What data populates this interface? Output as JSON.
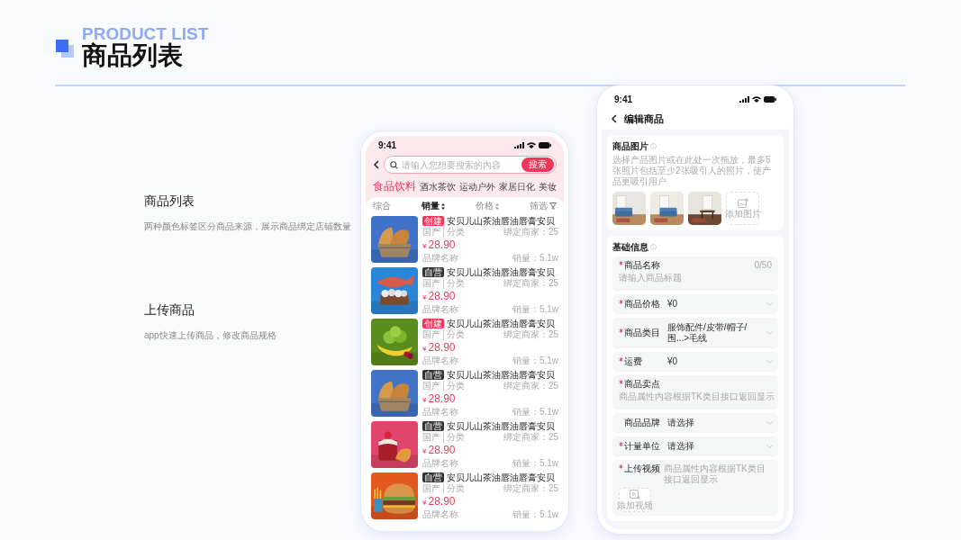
{
  "header": {
    "subtitle": "PRODUCT LIST",
    "title": "商品列表"
  },
  "features": [
    {
      "title": "商品列表",
      "description": "两种颜色标签区分商品来源，展示商品绑定店铺数量"
    },
    {
      "title": "上传商品",
      "description": "app快速上传商品，修改商品规格"
    }
  ],
  "list_screen": {
    "status_time": "9:41",
    "search": {
      "placeholder": "请输入您想要搜索的内容",
      "button": "搜索"
    },
    "tabs": [
      {
        "label": "食品饮料",
        "selected": true
      },
      {
        "label": "酒水茶饮",
        "selected": false
      },
      {
        "label": "运动户外",
        "selected": false
      },
      {
        "label": "家居日化",
        "selected": false
      },
      {
        "label": "美妆",
        "selected": false
      }
    ],
    "sort_options": [
      {
        "label": "综合",
        "kind": "plain",
        "selected": false
      },
      {
        "label": "销量",
        "kind": "sort",
        "selected": true
      },
      {
        "label": "价格",
        "kind": "sort",
        "selected": false
      },
      {
        "label": "筛选",
        "kind": "filter",
        "selected": false
      }
    ],
    "products": [
      {
        "tag": "创建",
        "color": "#f0375a",
        "title": "安贝儿山茶油唇油唇膏安贝",
        "origin": "国产",
        "category": "分类",
        "merchants": "绑定商家：25",
        "currency": "¥",
        "price": "28.90",
        "brand": "品牌名称",
        "sales": "销量：5.1w"
      },
      {
        "tag": "自营",
        "color": "#333333",
        "title": "安贝儿山茶油唇油唇膏安贝",
        "origin": "国产",
        "category": "分类",
        "merchants": "绑定商家：25",
        "currency": "¥",
        "price": "28.90",
        "brand": "品牌名称",
        "sales": "销量：5.1w"
      },
      {
        "tag": "创建",
        "color": "#f0375a",
        "title": "安贝儿山茶油唇油唇膏安贝",
        "origin": "国产",
        "category": "分类",
        "merchants": "绑定商家：25",
        "currency": "¥",
        "price": "28.90",
        "brand": "品牌名称",
        "sales": "销量：5.1w"
      },
      {
        "tag": "自营",
        "color": "#333333",
        "title": "安贝儿山茶油唇油唇膏安贝",
        "origin": "国产",
        "category": "分类",
        "merchants": "绑定商家：25",
        "currency": "¥",
        "price": "28.90",
        "brand": "品牌名称",
        "sales": "销量：5.1w"
      },
      {
        "tag": "自营",
        "color": "#333333",
        "title": "安贝儿山茶油唇油唇膏安贝",
        "origin": "国产",
        "category": "分类",
        "merchants": "绑定商家：25",
        "currency": "¥",
        "price": "28.90",
        "brand": "品牌名称",
        "sales": "销量：5.1w"
      },
      {
        "tag": "自营",
        "color": "#333333",
        "title": "安贝儿山茶油唇油唇膏安贝",
        "origin": "国产",
        "category": "分类",
        "merchants": "绑定商家：25",
        "currency": "¥",
        "price": "28.90",
        "brand": "品牌名称",
        "sales": "销量：5.1w"
      }
    ]
  },
  "edit_screen": {
    "status_time": "9:41",
    "title": "编辑商品",
    "images_section": {
      "title": "商品图片",
      "hint": "选择产品图片或在此处一次拖放，最多5张照片包括至少2张吸引人的照片，使产品更吸引用户",
      "add_button": "添加图片"
    },
    "basic_section": {
      "title": "基础信息",
      "fields": [
        {
          "kind": "textarea",
          "label": "商品名称",
          "required": true,
          "placeholder": "请输入商品标题",
          "counter": "0/50"
        },
        {
          "kind": "select",
          "label": "商品价格",
          "required": true,
          "value": "¥0"
        },
        {
          "kind": "select",
          "label": "商品类目",
          "required": true,
          "value": "服饰配件/皮带/帽子/围...>毛线"
        },
        {
          "kind": "select",
          "label": "运费",
          "required": true,
          "value": "¥0"
        },
        {
          "kind": "textarea",
          "label": "商品卖点",
          "required": true,
          "placeholder": "商品属性内容根据TK类目接口返回显示"
        },
        {
          "kind": "select",
          "label": "商品品牌",
          "required": false,
          "value": "请选择"
        },
        {
          "kind": "select",
          "label": "计量单位",
          "required": true,
          "value": "请选择"
        },
        {
          "kind": "video",
          "label": "上传视频",
          "required": true,
          "placeholder": "商品属性内容根据TK类目接口返回显示",
          "button": "添加视频"
        }
      ]
    }
  }
}
